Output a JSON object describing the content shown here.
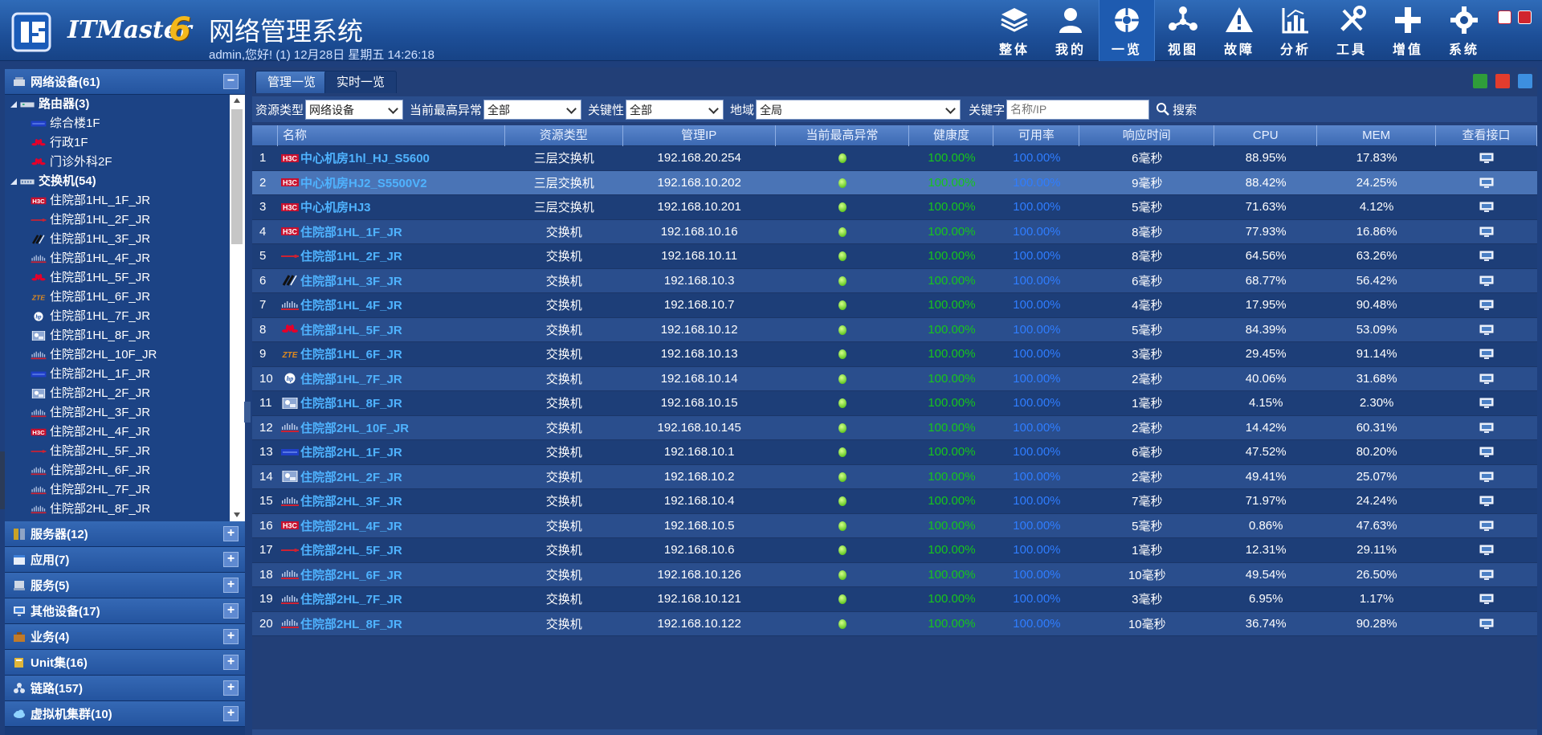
{
  "header": {
    "logo_text": "ITMaster",
    "logo_version": "6",
    "title": "网络管理系统",
    "status": "admin,您好! (1) 12月28日 星期五 14:26:18"
  },
  "nav": [
    {
      "label": "整体",
      "icon": "layers-icon"
    },
    {
      "label": "我的",
      "icon": "user-icon"
    },
    {
      "label": "一览",
      "icon": "overview-icon",
      "active": true
    },
    {
      "label": "视图",
      "icon": "topology-icon"
    },
    {
      "label": "故障",
      "icon": "warning-icon"
    },
    {
      "label": "分析",
      "icon": "chart-icon"
    },
    {
      "label": "工具",
      "icon": "tools-icon"
    },
    {
      "label": "增值",
      "icon": "plus-icon"
    },
    {
      "label": "系统",
      "icon": "gear-icon"
    }
  ],
  "sidebar": {
    "network_devices": "网络设备(61)",
    "tree": [
      {
        "label": "路由器(3)",
        "level": 0,
        "group": true,
        "icon": "router-icon"
      },
      {
        "label": "综合楼1F",
        "level": 1,
        "icon": "vendor-blue-icon"
      },
      {
        "label": "行政1F",
        "level": 1,
        "icon": "huawei-icon"
      },
      {
        "label": "门诊外科2F",
        "level": 1,
        "icon": "huawei-icon"
      },
      {
        "label": "交换机(54)",
        "level": 0,
        "group": true,
        "icon": "switch-icon"
      },
      {
        "label": "住院部1HL_1F_JR",
        "level": 1,
        "icon": "h3c-icon"
      },
      {
        "label": "住院部1HL_2F_JR",
        "level": 1,
        "icon": "vendor-red-line-icon"
      },
      {
        "label": "住院部1HL_3F_JR",
        "level": 1,
        "icon": "vendor-slash-icon"
      },
      {
        "label": "住院部1HL_4F_JR",
        "level": 1,
        "icon": "cisco-icon"
      },
      {
        "label": "住院部1HL_5F_JR",
        "level": 1,
        "icon": "huawei-icon"
      },
      {
        "label": "住院部1HL_6F_JR",
        "level": 1,
        "icon": "zte-icon"
      },
      {
        "label": "住院部1HL_7F_JR",
        "level": 1,
        "icon": "hp-icon"
      },
      {
        "label": "住院部1HL_8F_JR",
        "level": 1,
        "icon": "device-image-icon"
      },
      {
        "label": "住院部2HL_10F_JR",
        "level": 1,
        "icon": "cisco-icon"
      },
      {
        "label": "住院部2HL_1F_JR",
        "level": 1,
        "icon": "vendor-blue-icon"
      },
      {
        "label": "住院部2HL_2F_JR",
        "level": 1,
        "icon": "device-image-icon"
      },
      {
        "label": "住院部2HL_3F_JR",
        "level": 1,
        "icon": "cisco-icon"
      },
      {
        "label": "住院部2HL_4F_JR",
        "level": 1,
        "icon": "h3c-icon"
      },
      {
        "label": "住院部2HL_5F_JR",
        "level": 1,
        "icon": "vendor-red-line-icon"
      },
      {
        "label": "住院部2HL_6F_JR",
        "level": 1,
        "icon": "cisco-icon"
      },
      {
        "label": "住院部2HL_7F_JR",
        "level": 1,
        "icon": "cisco-icon"
      },
      {
        "label": "住院部2HL_8F_JR",
        "level": 1,
        "icon": "cisco-icon"
      }
    ],
    "sections": [
      {
        "label": "服务器(12)",
        "icon": "server-icon"
      },
      {
        "label": "应用(7)",
        "icon": "application-icon"
      },
      {
        "label": "服务(5)",
        "icon": "service-icon"
      },
      {
        "label": "其他设备(17)",
        "icon": "monitor-icon"
      },
      {
        "label": "业务(4)",
        "icon": "business-icon"
      },
      {
        "label": "Unit集(16)",
        "icon": "unit-icon"
      },
      {
        "label": "链路(157)",
        "icon": "link-icon"
      },
      {
        "label": "虚拟机集群(10)",
        "icon": "cloud-icon"
      }
    ]
  },
  "tabs": [
    {
      "label": "管理一览",
      "active": false
    },
    {
      "label": "实时一览",
      "active": true
    }
  ],
  "filters": {
    "resource_type_label": "资源类型",
    "resource_type_value": "网络设备",
    "max_alarm_label": "当前最高异常",
    "max_alarm_value": "全部",
    "criticality_label": "关键性",
    "criticality_value": "全部",
    "region_label": "地域",
    "region_value": "全局",
    "keyword_label": "关键字",
    "keyword_placeholder": "名称/IP",
    "search_label": "搜索"
  },
  "table": {
    "columns": [
      "名称",
      "资源类型",
      "管理IP",
      "当前最高异常",
      "健康度",
      "可用率",
      "响应时间",
      "CPU",
      "MEM",
      "查看接口"
    ],
    "rows": [
      {
        "no": "1",
        "name": "中心机房1hl_HJ_S5600",
        "icon": "h3c-icon",
        "type": "三层交换机",
        "ip": "192.168.20.254",
        "health": "100.00%",
        "avail": "100.00%",
        "resp": "6毫秒",
        "cpu": "88.95%",
        "mem": "17.83%"
      },
      {
        "no": "2",
        "name": "中心机房HJ2_S5500V2",
        "icon": "h3c-icon",
        "type": "三层交换机",
        "ip": "192.168.10.202",
        "health": "100.00%",
        "avail": "100.00%",
        "resp": "9毫秒",
        "cpu": "88.42%",
        "mem": "24.25%",
        "selected": true
      },
      {
        "no": "3",
        "name": "中心机房HJ3",
        "icon": "h3c-icon",
        "type": "三层交换机",
        "ip": "192.168.10.201",
        "health": "100.00%",
        "avail": "100.00%",
        "resp": "5毫秒",
        "cpu": "71.63%",
        "mem": "4.12%"
      },
      {
        "no": "4",
        "name": "住院部1HL_1F_JR",
        "icon": "h3c-icon",
        "type": "交换机",
        "ip": "192.168.10.16",
        "health": "100.00%",
        "avail": "100.00%",
        "resp": "8毫秒",
        "cpu": "77.93%",
        "mem": "16.86%"
      },
      {
        "no": "5",
        "name": "住院部1HL_2F_JR",
        "icon": "vendor-red-line-icon",
        "type": "交换机",
        "ip": "192.168.10.11",
        "health": "100.00%",
        "avail": "100.00%",
        "resp": "8毫秒",
        "cpu": "64.56%",
        "mem": "63.26%"
      },
      {
        "no": "6",
        "name": "住院部1HL_3F_JR",
        "icon": "vendor-slash-icon",
        "type": "交换机",
        "ip": "192.168.10.3",
        "health": "100.00%",
        "avail": "100.00%",
        "resp": "6毫秒",
        "cpu": "68.77%",
        "mem": "56.42%"
      },
      {
        "no": "7",
        "name": "住院部1HL_4F_JR",
        "icon": "cisco-icon",
        "type": "交换机",
        "ip": "192.168.10.7",
        "health": "100.00%",
        "avail": "100.00%",
        "resp": "4毫秒",
        "cpu": "17.95%",
        "mem": "90.48%"
      },
      {
        "no": "8",
        "name": "住院部1HL_5F_JR",
        "icon": "huawei-icon",
        "type": "交换机",
        "ip": "192.168.10.12",
        "health": "100.00%",
        "avail": "100.00%",
        "resp": "5毫秒",
        "cpu": "84.39%",
        "mem": "53.09%"
      },
      {
        "no": "9",
        "name": "住院部1HL_6F_JR",
        "icon": "zte-icon",
        "type": "交换机",
        "ip": "192.168.10.13",
        "health": "100.00%",
        "avail": "100.00%",
        "resp": "3毫秒",
        "cpu": "29.45%",
        "mem": "91.14%"
      },
      {
        "no": "10",
        "name": "住院部1HL_7F_JR",
        "icon": "hp-icon",
        "type": "交换机",
        "ip": "192.168.10.14",
        "health": "100.00%",
        "avail": "100.00%",
        "resp": "2毫秒",
        "cpu": "40.06%",
        "mem": "31.68%"
      },
      {
        "no": "11",
        "name": "住院部1HL_8F_JR",
        "icon": "device-image-icon",
        "type": "交换机",
        "ip": "192.168.10.15",
        "health": "100.00%",
        "avail": "100.00%",
        "resp": "1毫秒",
        "cpu": "4.15%",
        "mem": "2.30%"
      },
      {
        "no": "12",
        "name": "住院部2HL_10F_JR",
        "icon": "cisco-icon",
        "type": "交换机",
        "ip": "192.168.10.145",
        "health": "100.00%",
        "avail": "100.00%",
        "resp": "2毫秒",
        "cpu": "14.42%",
        "mem": "60.31%"
      },
      {
        "no": "13",
        "name": "住院部2HL_1F_JR",
        "icon": "vendor-blue-icon",
        "type": "交换机",
        "ip": "192.168.10.1",
        "health": "100.00%",
        "avail": "100.00%",
        "resp": "6毫秒",
        "cpu": "47.52%",
        "mem": "80.20%"
      },
      {
        "no": "14",
        "name": "住院部2HL_2F_JR",
        "icon": "device-image-icon",
        "type": "交换机",
        "ip": "192.168.10.2",
        "health": "100.00%",
        "avail": "100.00%",
        "resp": "2毫秒",
        "cpu": "49.41%",
        "mem": "25.07%"
      },
      {
        "no": "15",
        "name": "住院部2HL_3F_JR",
        "icon": "cisco-icon",
        "type": "交换机",
        "ip": "192.168.10.4",
        "health": "100.00%",
        "avail": "100.00%",
        "resp": "7毫秒",
        "cpu": "71.97%",
        "mem": "24.24%"
      },
      {
        "no": "16",
        "name": "住院部2HL_4F_JR",
        "icon": "h3c-icon",
        "type": "交换机",
        "ip": "192.168.10.5",
        "health": "100.00%",
        "avail": "100.00%",
        "resp": "5毫秒",
        "cpu": "0.86%",
        "mem": "47.63%"
      },
      {
        "no": "17",
        "name": "住院部2HL_5F_JR",
        "icon": "vendor-red-line-icon",
        "type": "交换机",
        "ip": "192.168.10.6",
        "health": "100.00%",
        "avail": "100.00%",
        "resp": "1毫秒",
        "cpu": "12.31%",
        "mem": "29.11%"
      },
      {
        "no": "18",
        "name": "住院部2HL_6F_JR",
        "icon": "cisco-icon",
        "type": "交换机",
        "ip": "192.168.10.126",
        "health": "100.00%",
        "avail": "100.00%",
        "resp": "10毫秒",
        "cpu": "49.54%",
        "mem": "26.50%"
      },
      {
        "no": "19",
        "name": "住院部2HL_7F_JR",
        "icon": "cisco-icon",
        "type": "交换机",
        "ip": "192.168.10.121",
        "health": "100.00%",
        "avail": "100.00%",
        "resp": "3毫秒",
        "cpu": "6.95%",
        "mem": "1.17%"
      },
      {
        "no": "20",
        "name": "住院部2HL_8F_JR",
        "icon": "cisco-icon",
        "type": "交换机",
        "ip": "192.168.10.122",
        "health": "100.00%",
        "avail": "100.00%",
        "resp": "10毫秒",
        "cpu": "36.74%",
        "mem": "90.28%"
      }
    ]
  },
  "colors": {
    "health_text": "#16c51c",
    "avail_text": "#2f7dff",
    "name_link": "#4fb3ff",
    "alarm_ok": "#3bb400"
  }
}
